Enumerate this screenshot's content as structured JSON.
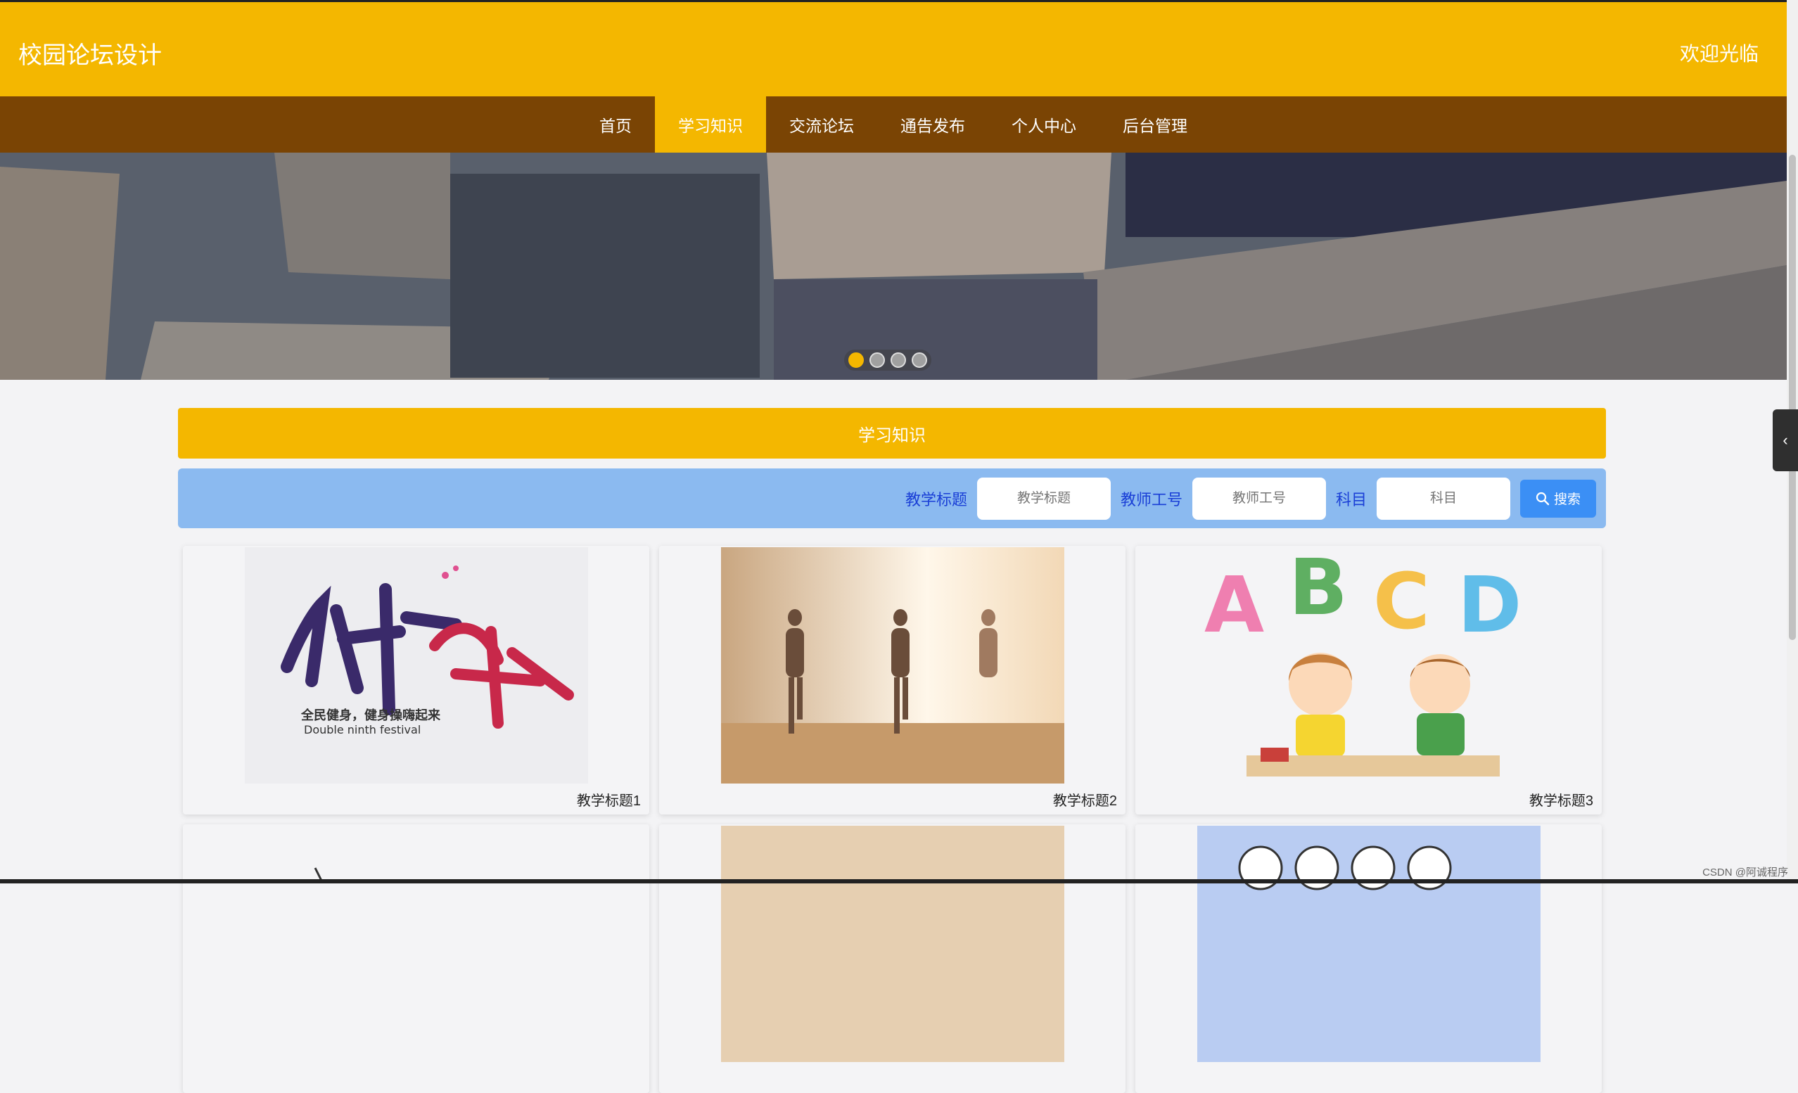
{
  "header": {
    "site_title": "校园论坛设计",
    "welcome": "欢迎光临"
  },
  "nav": {
    "items": [
      {
        "label": "首页",
        "active": false
      },
      {
        "label": "学习知识",
        "active": true
      },
      {
        "label": "交流论坛",
        "active": false
      },
      {
        "label": "通告发布",
        "active": false
      },
      {
        "label": "个人中心",
        "active": false
      },
      {
        "label": "后台管理",
        "active": false
      }
    ]
  },
  "banner": {
    "slides": 4,
    "active_slide": 1
  },
  "section": {
    "title": "学习知识"
  },
  "search": {
    "fields": [
      {
        "label": "教学标题",
        "placeholder": "教学标题"
      },
      {
        "label": "教师工号",
        "placeholder": "教师工号"
      },
      {
        "label": "科目",
        "placeholder": "科目"
      }
    ],
    "button_label": "搜索"
  },
  "cards": [
    {
      "title": "教学标题1",
      "image": "fitness-calligraphy",
      "img_text_1": "全民健身，健身操嗨起来",
      "img_text_2": "Double ninth festival"
    },
    {
      "title": "教学标题2",
      "image": "yoga-class"
    },
    {
      "title": "教学标题3",
      "image": "abcd-kids"
    },
    {
      "title": "",
      "image": "partial"
    },
    {
      "title": "",
      "image": "partial"
    },
    {
      "title": "",
      "image": "partial"
    }
  ],
  "watermark": "CSDN @阿诚程序",
  "colors": {
    "brand": "#f4b700",
    "nav_bg": "#7a4404",
    "search_bg": "#8bbaf0",
    "accent": "#3b8ff5"
  }
}
